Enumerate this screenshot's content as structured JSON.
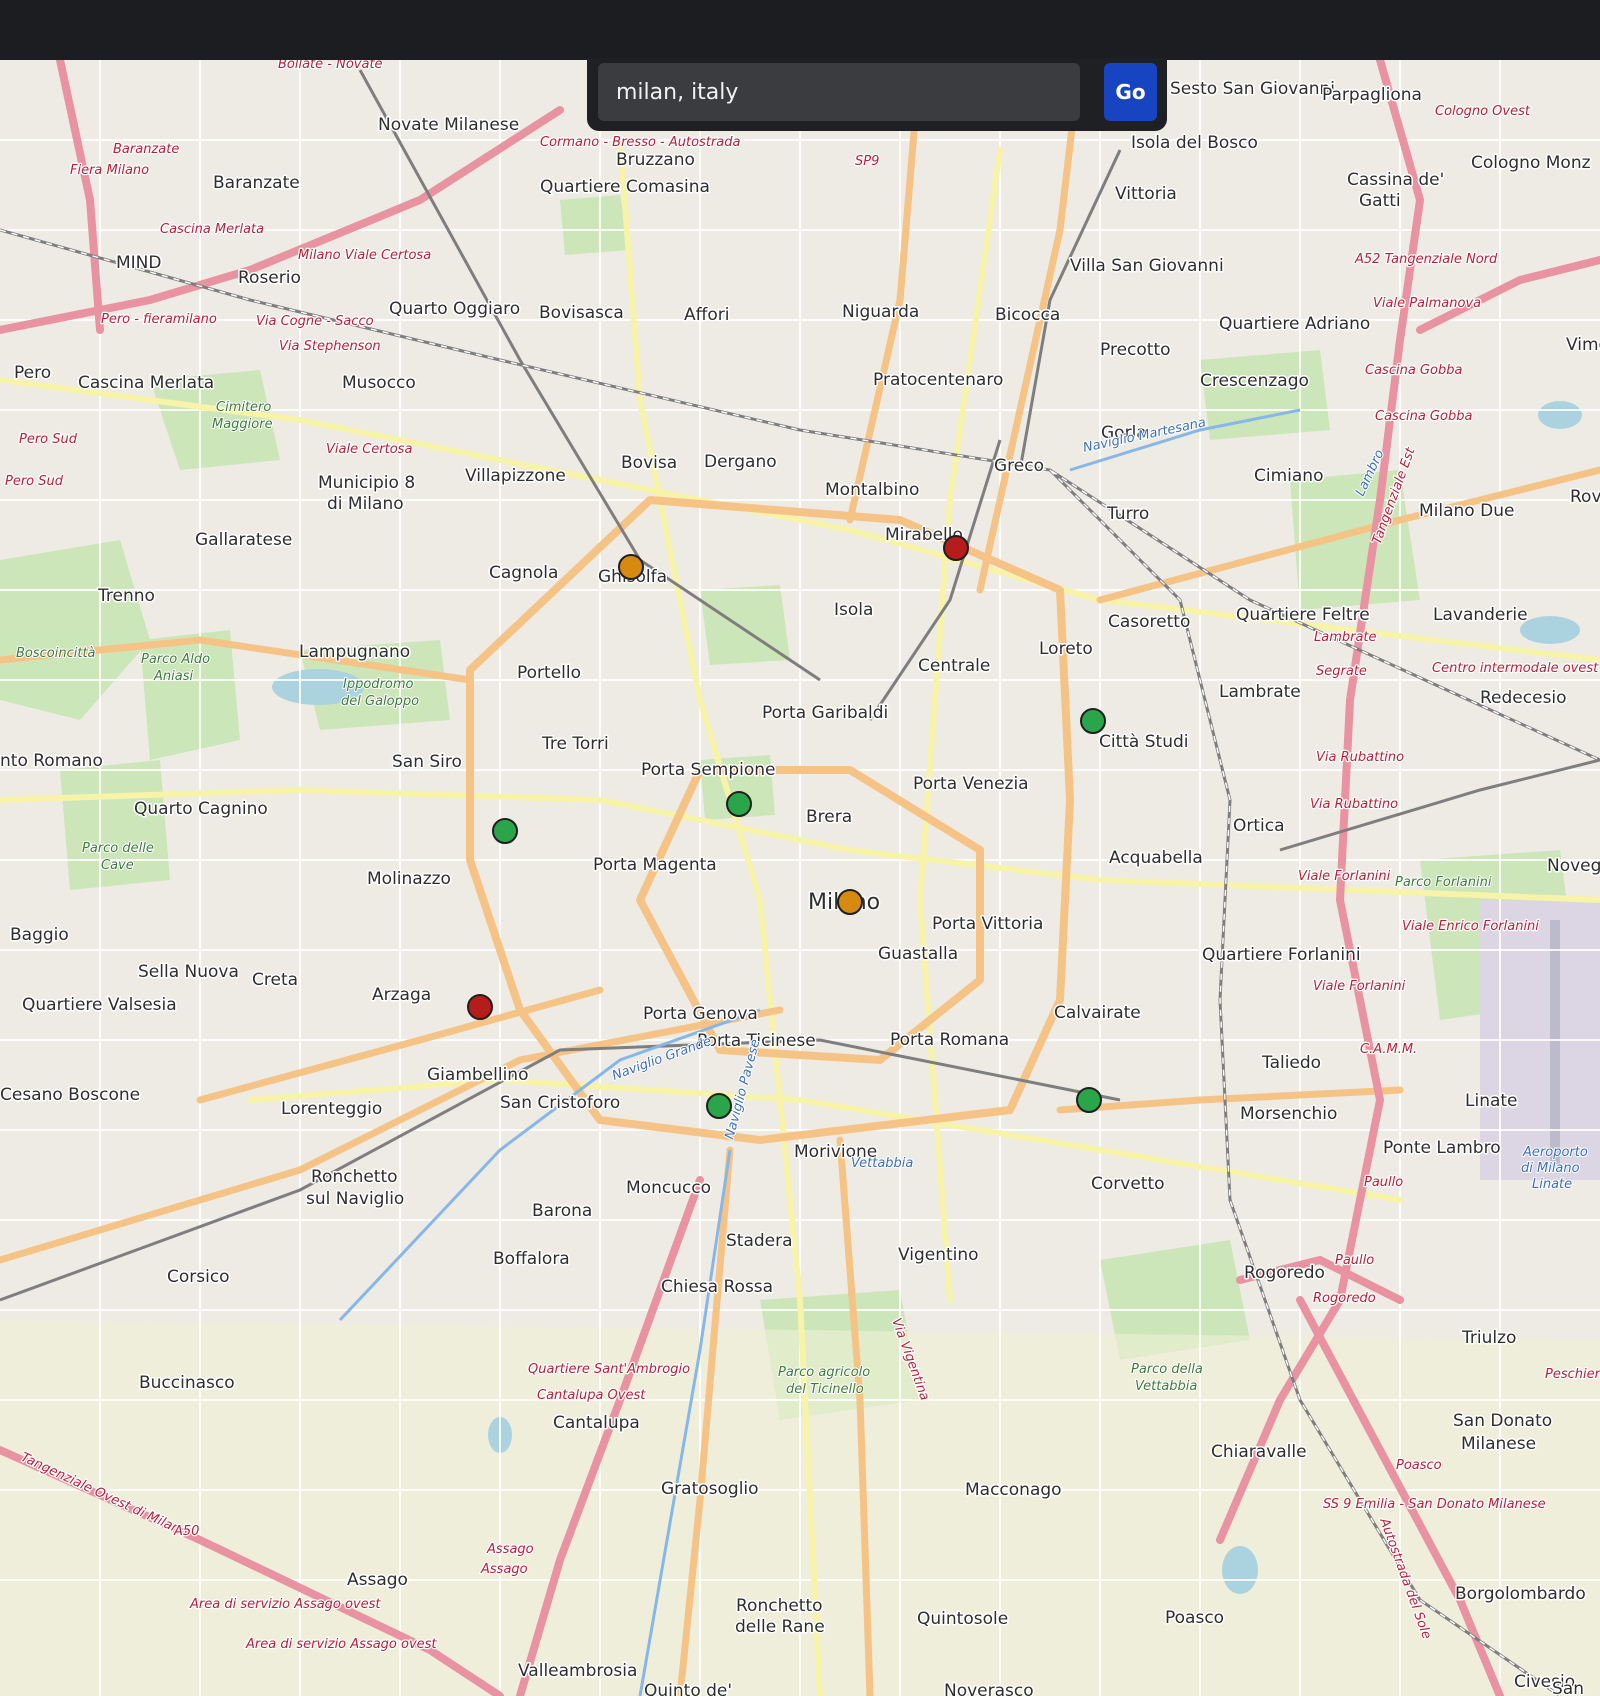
{
  "search": {
    "value": "milan, italy",
    "button": "Go"
  },
  "colors": {
    "topbar": "#1b1d20",
    "go_button": "#1745c2",
    "marker_green": "#2aa54a",
    "marker_orange": "#d78a10",
    "marker_red": "#b51c1c"
  },
  "markers": [
    {
      "status": "green"
    },
    {
      "status": "green"
    },
    {
      "status": "green"
    },
    {
      "status": "green"
    },
    {
      "status": "green"
    },
    {
      "status": "orange"
    },
    {
      "status": "orange"
    },
    {
      "status": "red"
    },
    {
      "status": "red"
    }
  ],
  "labels": {
    "place": [
      "Novate Milanese",
      "Bruzzano",
      "Quartiere Comasina",
      "Baranzate",
      "MIND",
      "Roserio",
      "Quarto Oggiaro",
      "Bovisasca",
      "Affori",
      "Niguarda",
      "Bicocca",
      "Pratocentenaro",
      "Pero",
      "Cascina Merlata",
      "Musocco",
      "Villapizzone",
      "Bovisa",
      "Dergano",
      "Montalbino",
      "Mirabello",
      "Greco",
      "Gorla",
      "Precotto",
      "Cimiano",
      "Turro",
      "Municipio 8",
      "di Milano",
      "Gallaratese",
      "Trenno",
      "Cagnola",
      "Ghisolfa",
      "Isola",
      "Centrale",
      "Loreto",
      "Casoretto",
      "Lampugnano",
      "Portello",
      "Porta Garibaldi",
      "Lambrate",
      "Città Studi",
      "Tre Torri",
      "Porta Sempione",
      "Brera",
      "Porta Venezia",
      "San Siro",
      "Quarto Cagnino",
      "Molinazzo",
      "Porta Magenta",
      "Ortica",
      "Acquabella",
      "Porta Vittoria",
      "Guastalla",
      "Baggio",
      "Sella Nuova",
      "Creta",
      "Arzaga",
      "Quartiere Valsesia",
      "Porta Genova",
      "Porta Ticinese",
      "Porta Romana",
      "Calvairate",
      "Giambellino",
      "San Cristoforo",
      "Lorenteggio",
      "Cesano Boscone",
      "Morivione",
      "Corvetto",
      "Moncucco",
      "Barona",
      "Ronchetto",
      "sul Naviglio",
      "Stadera",
      "Boffalora",
      "Vigentino",
      "Chiesa Rossa",
      "Corsico",
      "Rogoredo",
      "Buccinasco",
      "Cantalupa",
      "Chiaravalle",
      "Gratosoglio",
      "Macconago",
      "Assago",
      "Ronchetto",
      "delle Rane",
      "Quintosole",
      "Valleambrosia",
      "Quinto de'",
      "Noverasco",
      "Villa San Giovanni",
      "Quartiere Adriano",
      "Crescenzago",
      "Vittoria",
      "Isola del Bosco",
      "Sesto San Giovanni",
      "Parpagliona",
      "Cologno Monz",
      "Cassina de'",
      "Gatti",
      "Milano Due",
      "Lavanderie",
      "Quartiere Feltre",
      "Redecesio",
      "Quartiere Forlanini",
      "Taliedo",
      "Morsenchio",
      "Ponte Lambro",
      "Linate",
      "San Donato",
      "Milanese",
      "Triulzo",
      "Borgolombardo",
      "Poasco",
      "Civesio",
      "Vimo",
      "Rova",
      "Novegr",
      "San",
      "nto Romano"
    ],
    "big": [
      "Milano"
    ],
    "road": [
      "Bollate - Novate",
      "Baranzate",
      "Fiera Milano",
      "Cascina Merlata",
      "Milano Viale Certosa",
      "Pero - fieramilano",
      "Via Cogne - Sacco",
      "Via Stephenson",
      "Pero Sud",
      "Pero Sud",
      "Viale Certosa",
      "Cormano - Bresso - Autostrada",
      "SP9",
      "A52 Tangenziale Nord",
      "Viale Palmanova",
      "Cascina Gobba",
      "Cascina Gobba",
      "Cologno Ovest",
      "Lambrate",
      "Segrate",
      "Via Rubattino",
      "Via Rubattino",
      "Viale Forlanini",
      "Viale Forlanini",
      "Viale Enrico Forlanini",
      "C.A.M.M.",
      "Paullo",
      "Paullo",
      "Rogoredo",
      "Quartiere Sant'Ambrogio",
      "Cantalupa Ovest",
      "Assago",
      "Assago",
      "Area di servizio Assago ovest",
      "Area di servizio Assago ovest",
      "Poasco",
      "SS 9 Emilia - San Donato Milanese",
      "Peschiera",
      "Tangenziale Ovest di Milano",
      "A50",
      "Centro intermodale ovest",
      "Tangenziale Est",
      "Autostrada del Sole",
      "Via Vigentina"
    ],
    "park": [
      "Cimitero",
      "Maggiore",
      "Parco Aldo",
      "Aniasi",
      "Ippodromo",
      "del Galoppo",
      "Boscoincittà",
      "Parco delle",
      "Cave",
      "Parco Forlanini",
      "Parco agricolo",
      "del Ticinello",
      "Parco della",
      "Vettabbia"
    ],
    "water": [
      "Naviglio Grande",
      "Naviglio Pavese",
      "Naviglio Martesana",
      "Vettabbia",
      "Lambro",
      "Aeroporto",
      "di Milano",
      "Linate"
    ]
  }
}
